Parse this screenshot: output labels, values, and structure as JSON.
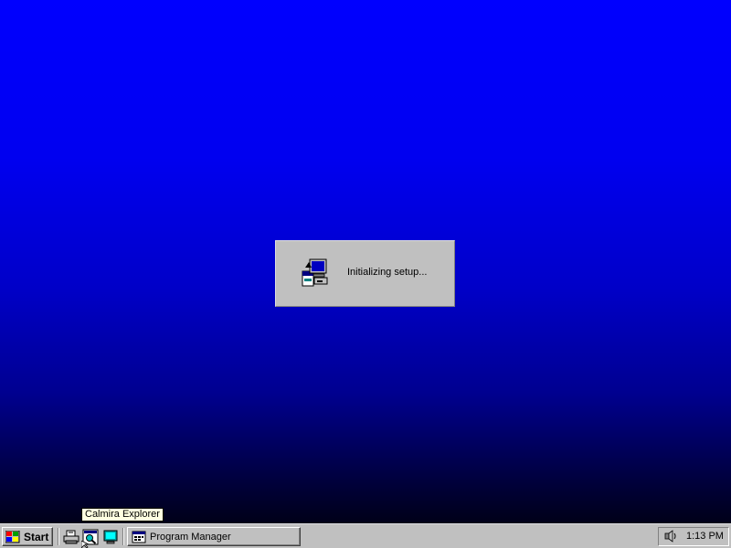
{
  "setup_dialog": {
    "message": "Initializing setup...",
    "icon": "setup-computer-icon"
  },
  "tooltip": {
    "text": "Calmira Explorer"
  },
  "taskbar": {
    "start_label": "Start",
    "start_icon": "windows-flag-icon",
    "quick_launch": [
      {
        "name": "printer-icon"
      },
      {
        "name": "explorer-icon"
      },
      {
        "name": "desktop-icon"
      }
    ],
    "tasks": [
      {
        "label": "Program Manager",
        "icon": "program-manager-icon"
      }
    ],
    "tray": {
      "icon": "speaker-icon",
      "clock": "1:13 PM"
    }
  },
  "colors": {
    "desktop_top": "#0000fe",
    "desktop_bottom": "#000018",
    "face": "#c0c0c0",
    "tooltip_bg": "#ffffe1"
  }
}
